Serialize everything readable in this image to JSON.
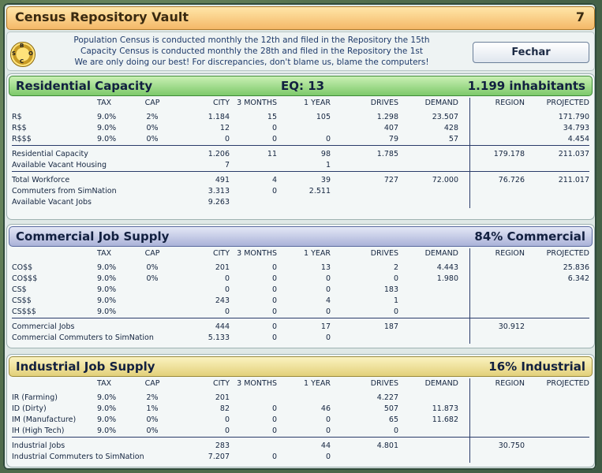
{
  "window": {
    "title": "Census Repository Vault",
    "count": "7"
  },
  "info": {
    "lines": [
      "Population Census is conducted monthly the 12th and filed in the Repository the 15th",
      "Capacity Census is conducted monthly the 28th and filed in the Repository the 1st",
      "We are only doing our best! For discrepancies, don't blame us, blame the computers!"
    ],
    "seal_letters": [
      "B",
      "S",
      "C",
      "O"
    ],
    "close_label": "Fechar"
  },
  "columns": {
    "tax": "TAX",
    "cap": "CAP",
    "city": "CITY",
    "m3": "3 MONTHS",
    "y1": "1 YEAR",
    "drives": "DRIVES",
    "demand": "DEMAND",
    "region": "REGION",
    "projected": "PROJECTED"
  },
  "residential": {
    "title": "Residential Capacity",
    "eq": "EQ: 13",
    "summary": "1.199 inhabitants",
    "rows": [
      {
        "label": "R$",
        "tax": "9.0%",
        "cap": "2%",
        "city": "1.184",
        "m3": "15",
        "y1": "105",
        "drives": "1.298",
        "demand": "23.507",
        "region": "",
        "projected": "171.790"
      },
      {
        "label": "R$$",
        "tax": "9.0%",
        "cap": "0%",
        "city": "12",
        "m3": "0",
        "y1": "",
        "drives": "407",
        "demand": "428",
        "region": "",
        "projected": "34.793"
      },
      {
        "label": "R$$$",
        "tax": "9.0%",
        "cap": "0%",
        "city": "0",
        "m3": "0",
        "y1": "0",
        "drives": "79",
        "demand": "57",
        "region": "",
        "projected": "4.454"
      }
    ],
    "totals": [
      {
        "label": "Residential Capacity",
        "city": "1.206",
        "m3": "11",
        "y1": "98",
        "drives": "1.785",
        "demand": "",
        "region": "179.178",
        "projected": "211.037"
      },
      {
        "label": "Available Vacant Housing",
        "city": "7",
        "m3": "",
        "y1": "1",
        "drives": "",
        "demand": "",
        "region": "",
        "projected": ""
      }
    ],
    "workforce": [
      {
        "label": "Total Workforce",
        "city": "491",
        "m3": "4",
        "y1": "39",
        "drives": "727",
        "demand": "72.000",
        "region": "76.726",
        "projected": "211.017"
      },
      {
        "label": "Commuters from SimNation",
        "city": "3.313",
        "m3": "0",
        "y1": "2.511",
        "drives": "",
        "demand": "",
        "region": "",
        "projected": ""
      },
      {
        "label": "Available Vacant Jobs",
        "city": "9.263",
        "m3": "",
        "y1": "",
        "drives": "",
        "demand": "",
        "region": "",
        "projected": ""
      }
    ]
  },
  "commercial": {
    "title": "Commercial Job Supply",
    "summary": "84% Commercial",
    "rows": [
      {
        "label": "CO$$",
        "tax": "9.0%",
        "cap": "0%",
        "city": "201",
        "m3": "0",
        "y1": "13",
        "drives": "2",
        "demand": "4.443",
        "region": "",
        "projected": "25.836"
      },
      {
        "label": "CO$$$",
        "tax": "9.0%",
        "cap": "0%",
        "city": "0",
        "m3": "0",
        "y1": "0",
        "drives": "0",
        "demand": "1.980",
        "region": "",
        "projected": "6.342"
      },
      {
        "label": "CS$",
        "tax": "9.0%",
        "cap": "",
        "city": "0",
        "m3": "0",
        "y1": "0",
        "drives": "183",
        "demand": "",
        "region": "",
        "projected": ""
      },
      {
        "label": "CS$$",
        "tax": "9.0%",
        "cap": "",
        "city": "243",
        "m3": "0",
        "y1": "4",
        "drives": "1",
        "demand": "",
        "region": "",
        "projected": ""
      },
      {
        "label": "CS$$$",
        "tax": "9.0%",
        "cap": "",
        "city": "0",
        "m3": "0",
        "y1": "0",
        "drives": "0",
        "demand": "",
        "region": "",
        "projected": ""
      }
    ],
    "totals": [
      {
        "label": "Commercial Jobs",
        "city": "444",
        "m3": "0",
        "y1": "17",
        "drives": "187",
        "demand": "",
        "region": "30.912",
        "projected": ""
      },
      {
        "label": "Commercial Commuters to SimNation",
        "city": "5.133",
        "m3": "0",
        "y1": "0",
        "drives": "",
        "demand": "",
        "region": "",
        "projected": ""
      }
    ]
  },
  "industrial": {
    "title": "Industrial Job Supply",
    "summary": "16% Industrial",
    "rows": [
      {
        "label": "IR (Farming)",
        "tax": "9.0%",
        "cap": "2%",
        "city": "201",
        "m3": "",
        "y1": "",
        "drives": "4.227",
        "demand": "",
        "region": "",
        "projected": ""
      },
      {
        "label": "ID (Dirty)",
        "tax": "9.0%",
        "cap": "1%",
        "city": "82",
        "m3": "0",
        "y1": "46",
        "drives": "507",
        "demand": "11.873",
        "region": "",
        "projected": ""
      },
      {
        "label": "IM (Manufacture)",
        "tax": "9.0%",
        "cap": "0%",
        "city": "0",
        "m3": "0",
        "y1": "0",
        "drives": "65",
        "demand": "11.682",
        "region": "",
        "projected": ""
      },
      {
        "label": "IH (High Tech)",
        "tax": "9.0%",
        "cap": "0%",
        "city": "0",
        "m3": "0",
        "y1": "0",
        "drives": "0",
        "demand": "",
        "region": "",
        "projected": ""
      }
    ],
    "totals": [
      {
        "label": "Industrial Jobs",
        "city": "283",
        "m3": "",
        "y1": "44",
        "drives": "4.801",
        "demand": "",
        "region": "30.750",
        "projected": ""
      },
      {
        "label": "Industrial Commuters to SimNation",
        "city": "7.207",
        "m3": "0",
        "y1": "0",
        "drives": "",
        "demand": "",
        "region": "",
        "projected": ""
      }
    ]
  }
}
